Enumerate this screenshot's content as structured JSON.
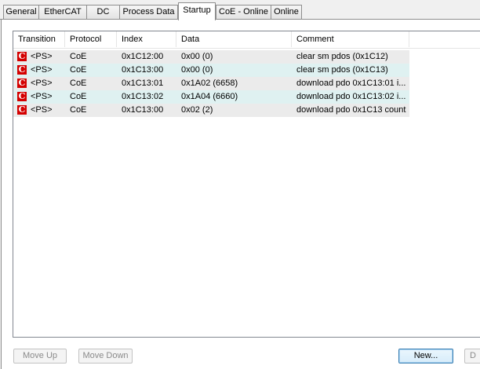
{
  "tabs": [
    {
      "label": "General"
    },
    {
      "label": "EtherCAT"
    },
    {
      "label": "DC"
    },
    {
      "label": "Process Data"
    },
    {
      "label": "Startup"
    },
    {
      "label": "CoE - Online"
    },
    {
      "label": "Online"
    }
  ],
  "active_tab": "Startup",
  "table": {
    "columns": [
      "Transition",
      "Protocol",
      "Index",
      "Data",
      "Comment"
    ],
    "rows": [
      {
        "icon": "C",
        "transition": "<PS>",
        "protocol": "CoE",
        "index": "0x1C12:00",
        "data": "0x00 (0)",
        "comment": "clear sm pdos (0x1C12)"
      },
      {
        "icon": "C",
        "transition": "<PS>",
        "protocol": "CoE",
        "index": "0x1C13:00",
        "data": "0x00 (0)",
        "comment": "clear sm pdos (0x1C13)"
      },
      {
        "icon": "C",
        "transition": "<PS>",
        "protocol": "CoE",
        "index": "0x1C13:01",
        "data": "0x1A02 (6658)",
        "comment": "download pdo 0x1C13:01 i..."
      },
      {
        "icon": "C",
        "transition": "<PS>",
        "protocol": "CoE",
        "index": "0x1C13:02",
        "data": "0x1A04 (6660)",
        "comment": "download pdo 0x1C13:02 i..."
      },
      {
        "icon": "C",
        "transition": "<PS>",
        "protocol": "CoE",
        "index": "0x1C13:00",
        "data": "0x02 (2)",
        "comment": "download pdo 0x1C13 count"
      }
    ]
  },
  "buttons": {
    "move_up": "Move Up",
    "move_down": "Move Down",
    "new": "New...",
    "delete_partial": "D"
  },
  "colors": {
    "row_odd": "#ebebeb",
    "row_even": "#dff1f1",
    "coe_icon": "#d40000"
  }
}
